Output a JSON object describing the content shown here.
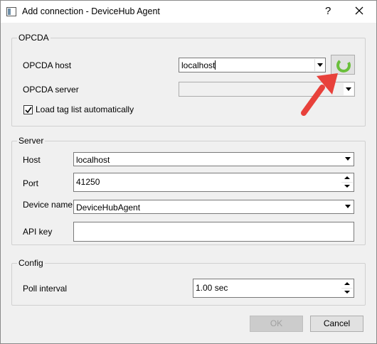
{
  "window": {
    "title": "Add connection - DeviceHub Agent",
    "help_glyph": "?",
    "icons": {
      "app": "window-app-icon",
      "close": "close-icon"
    }
  },
  "opcda": {
    "group_title": "OPCDA",
    "host_label": "OPCDA host",
    "host_value": "localhost",
    "server_label": "OPCDA server",
    "server_value": "",
    "refresh_icon": "refresh-icon",
    "refresh_color": "#6abf3b",
    "load_tags_label": "Load tag list automatically",
    "load_tags_checked": true
  },
  "server": {
    "group_title": "Server",
    "host_label": "Host",
    "host_value": "localhost",
    "port_label": "Port",
    "port_value": "41250",
    "device_label": "Device name",
    "device_value": "DeviceHubAgent",
    "apikey_label": "API key",
    "apikey_value": ""
  },
  "config": {
    "group_title": "Config",
    "poll_label": "Poll interval",
    "poll_value": "1.00 sec"
  },
  "buttons": {
    "ok_label": "OK",
    "ok_enabled": false,
    "cancel_label": "Cancel"
  },
  "annotation": {
    "color": "#e8413b",
    "icon": "pointer-arrow-icon"
  }
}
